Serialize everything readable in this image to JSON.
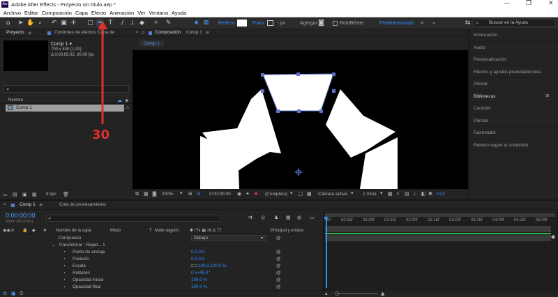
{
  "window": {
    "title": "Adobe After Effects - Proyecto sin título.aep *",
    "logo": "Ae"
  },
  "menu": [
    "Archivo",
    "Editar",
    "Composición",
    "Capa",
    "Efecto",
    "Animación",
    "Ver",
    "Ventana",
    "Ayuda"
  ],
  "toolbar": {
    "relleno_label": "Relleno",
    "trazo_label": "Trazo",
    "px_label": "- px",
    "agregar_label": "Agregar:",
    "rotobezier_label": "RotoBézier",
    "workspace_label": "Predeterminado",
    "search_placeholder": "Buscar en la Ayuda"
  },
  "annotation": {
    "number": "30",
    "color": "#e03131"
  },
  "project_panel": {
    "tab_project": "Proyecto",
    "tab_effects": "Controles de efectos Capa de",
    "comp_name": "Comp 1 ▾",
    "comp_size": "700 x 400 (1,00)",
    "comp_duration": "Δ 0:00:05:02, 30,00 fps",
    "search_icon_label": "⌕",
    "col_name": "Nombre",
    "item_name": "Comp 1",
    "bpc": "8 bpc"
  },
  "comp_panel": {
    "tab_label": "Composición",
    "tab_comp": "Comp 1",
    "sub_tab": "Comp 1",
    "zoom": "200%",
    "timecode": "0:00:00:00",
    "resolution": "(Completa)",
    "camera": "Cámara activa",
    "views": "1 Vista",
    "exposure": "+0,0"
  },
  "right_panel": {
    "items": [
      "Información",
      "Audio",
      "Previsualización",
      "Efectos y ajustes preestablecidos",
      "Alinear",
      "Bibliotecas",
      "Carácter",
      "Párrafo",
      "Rastreador",
      "Relleno según el contenido"
    ]
  },
  "timeline": {
    "tab_comp": "Comp 1",
    "tab_queue": "Cola de procesamiento",
    "timecode": "0:00:00:00",
    "timecode_sub": "00000 (30,00 fps)",
    "col_name": "Nombre de la capa",
    "col_mode": "Modo",
    "col_t": "T",
    "col_matte": "Mate seguim.",
    "col_parent": "Principal y enlace",
    "ruler": [
      "0f",
      "00:15f",
      "01:00f",
      "01:15f",
      "02:00f",
      "02:15f",
      "03:00f",
      "03:15f",
      "04:00f",
      "04:15f",
      "05:00f"
    ],
    "rows": [
      {
        "label": "Compuesto",
        "value": "Debajo"
      },
      {
        "label": "Transformar : Repet... 1",
        "value": ""
      },
      {
        "label": "Punto de anclaje",
        "value": "0,0,0,0"
      },
      {
        "label": "Posición",
        "value": "0,0,0,0"
      },
      {
        "label": "Escala",
        "value": "100,0,100,0 %"
      },
      {
        "label": "Rotación",
        "value": "0 x+45,0°"
      },
      {
        "label": "Opacidad inicial",
        "value": "100,0 %"
      },
      {
        "label": "Opacidad final",
        "value": "100,0 %"
      }
    ]
  }
}
